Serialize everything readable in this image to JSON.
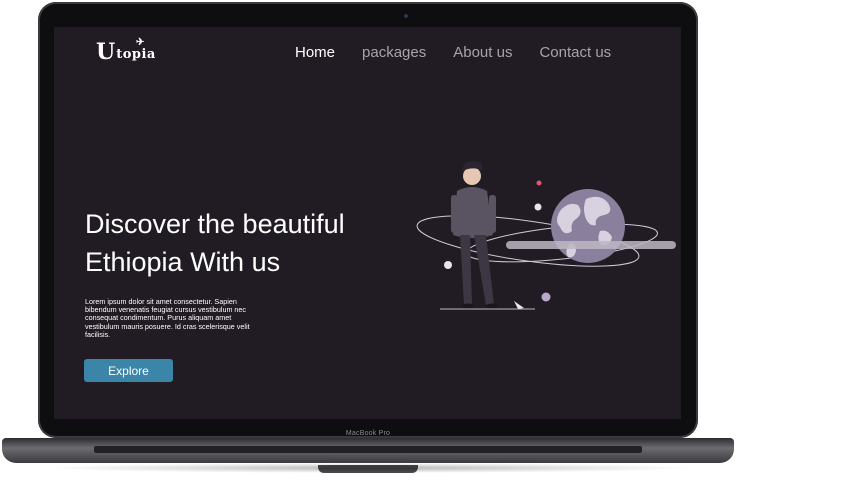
{
  "device": {
    "model_label": "MacBook Pro"
  },
  "site": {
    "logo": {
      "first_letter": "U",
      "rest": "topia"
    },
    "nav": [
      {
        "label": "Home",
        "active": true
      },
      {
        "label": "packages",
        "active": false
      },
      {
        "label": "About us",
        "active": false
      },
      {
        "label": "Contact us",
        "active": false
      }
    ],
    "hero": {
      "headline_line1": "Discover the beautiful",
      "headline_line2": "Ethiopia With us",
      "body": " Lorem ipsum dolor sit amet consectetur. Sapien bibendum venenatis feugiat cursus vestibulum nec consequat condimentum. Purus aliquam amet vestibulum mauris posuere. Id cras scelerisque velit facilisis.",
      "cta_label": "Explore"
    }
  },
  "colors": {
    "screen_bg": "#211c23",
    "accent_button": "#3b86a8",
    "globe": "#8a7f9c",
    "nav_inactive": "#a6a3aa"
  }
}
